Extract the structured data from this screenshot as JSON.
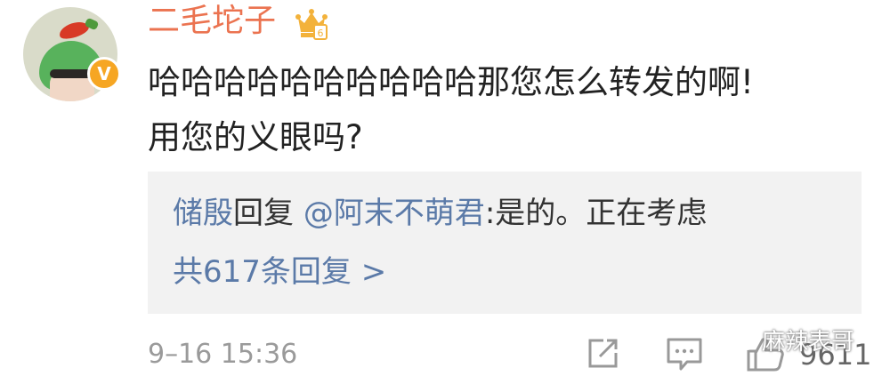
{
  "user": {
    "name": "二毛坨子",
    "verified_badge": "V",
    "level_badge": "6"
  },
  "comment": {
    "text_line1": "哈哈哈哈哈哈哈哈哈哈那您怎么转发的啊!",
    "text_line2": "用您的义眼吗?"
  },
  "reply_preview": {
    "author": "储殷",
    "action": "回复",
    "mention": "@阿末不萌君",
    "text": ":是的。正在考虑",
    "more_replies_label": "共617条回复 >"
  },
  "footer": {
    "timestamp": "9–16 15:36",
    "like_count": "9611"
  },
  "watermark": {
    "text": "麻辣表哥"
  },
  "colors": {
    "username": "#eb7350",
    "link": "#5b7aa8",
    "reply_bg": "#f2f2f2",
    "badge": "#f6a623"
  },
  "icons": [
    "share-icon",
    "comment-icon",
    "like-icon",
    "crown-icon",
    "wechat-icon"
  ]
}
